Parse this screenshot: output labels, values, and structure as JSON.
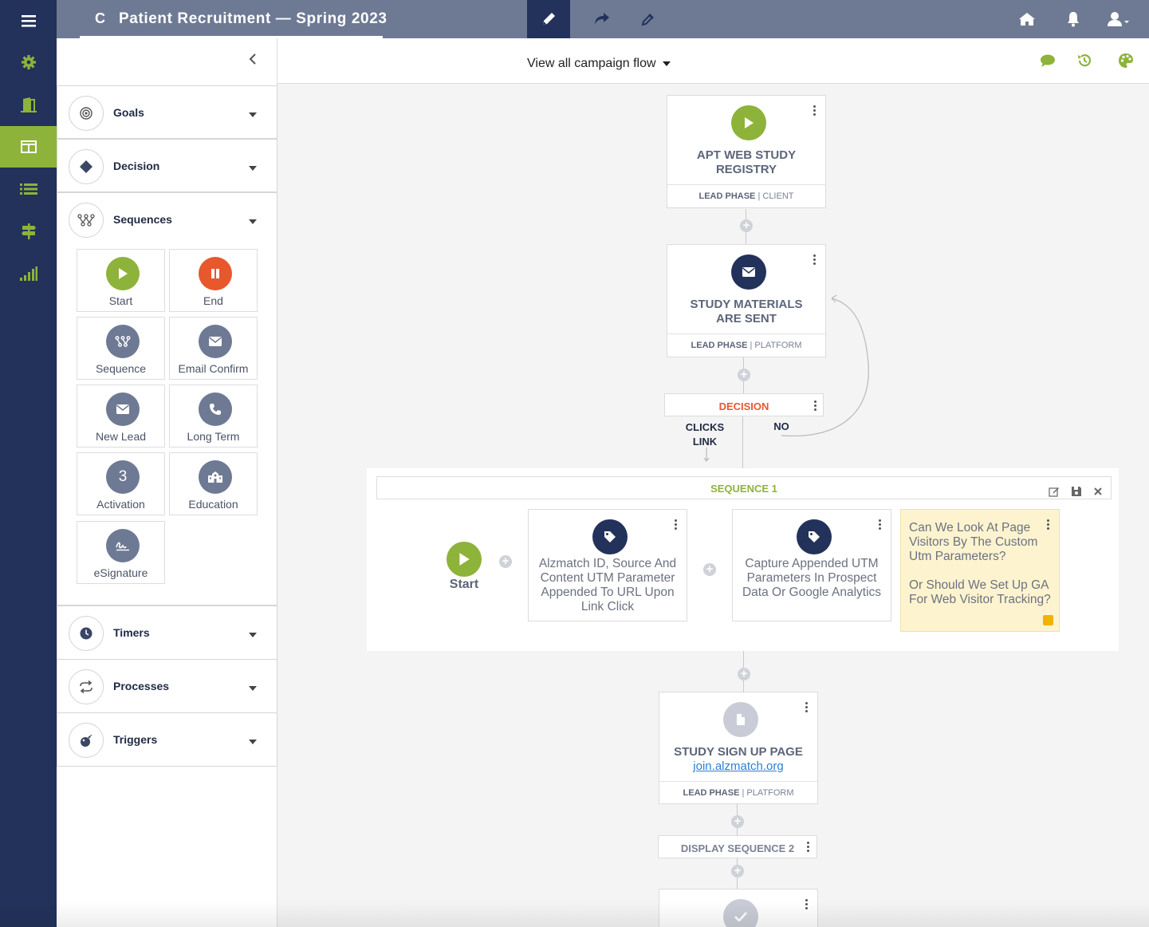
{
  "header": {
    "title_initial": "C",
    "title": "Patient Recruitment — Spring 2023"
  },
  "nav": {
    "icons": [
      "menu-icon",
      "gear-icon",
      "door-icon",
      "board-icon",
      "list-icon",
      "signpost-icon",
      "signal-icon"
    ],
    "active": "board-icon"
  },
  "toolbar": {
    "icons": [
      "pencil-icon",
      "share-icon",
      "eyedropper-icon"
    ],
    "right_icons": [
      "home-icon",
      "bell-icon",
      "user-icon"
    ]
  },
  "canvas_header": {
    "view_label": "View all campaign flow",
    "right_icons": [
      "comment-icon",
      "history-icon",
      "palette-icon"
    ]
  },
  "panel": {
    "sections": [
      {
        "label": "Goals",
        "icon": "target-icon"
      },
      {
        "label": "Decision",
        "icon": "diamond-icon"
      },
      {
        "label": "Sequences",
        "icon": "sequence-icon"
      },
      {
        "label": "Timers",
        "icon": "clock-icon"
      },
      {
        "label": "Processes",
        "icon": "repeat-icon"
      },
      {
        "label": "Triggers",
        "icon": "bomb-icon"
      }
    ],
    "tiles": [
      {
        "label": "Start",
        "icon": "play-icon"
      },
      {
        "label": "End",
        "icon": "pause-icon"
      },
      {
        "label": "Sequence",
        "icon": "sequence-icon"
      },
      {
        "label": "Email Confirm",
        "icon": "envelope-icon"
      },
      {
        "label": "New Lead",
        "icon": "envelope-icon"
      },
      {
        "label": "Long Term",
        "icon": "phone-icon"
      },
      {
        "label": "Activation",
        "icon": "number-three-icon",
        "glyph": "3"
      },
      {
        "label": "Education",
        "icon": "school-icon"
      },
      {
        "label": "eSignature",
        "icon": "signature-icon"
      }
    ]
  },
  "flow": {
    "node1": {
      "title_line1": "APT WEB STUDY",
      "title_line2": "REGISTRY",
      "phase": "LEAD PHASE",
      "owner": "CLIENT"
    },
    "node2": {
      "title_line1": "STUDY MATERIALS",
      "title_line2": "ARE SENT",
      "phase": "LEAD PHASE",
      "owner": "PLATFORM"
    },
    "decision": {
      "label": "DECISION",
      "yes_line1": "CLICKS",
      "yes_line2": "LINK",
      "no": "NO"
    },
    "sequence": {
      "title": "SEQUENCE 1",
      "start_label": "Start",
      "step1": "Alzmatch ID, Source And Content UTM Parameter Appended To URL Upon Link Click",
      "step2": "Capture Appended UTM Parameters In Prospect Data Or Google Analytics",
      "note": "Can We Look At Page Visitors By The Custom Utm Parameters?\n\nOr Should We Set Up GA For Web Visitor Tracking?"
    },
    "node3": {
      "title": "STUDY SIGN UP PAGE",
      "link": "join.alzmatch.org",
      "phase": "LEAD PHASE",
      "owner": "PLATFORM"
    },
    "display_sequence": "DISPLAY SEQUENCE 2"
  },
  "colors": {
    "nav_bg": "#23325a",
    "accent_green": "#8db33a",
    "topbar": "#6e7a94",
    "end_red": "#e8582d",
    "note_bg": "#fdf4cf"
  }
}
